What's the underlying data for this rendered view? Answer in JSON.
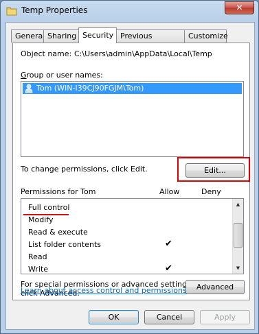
{
  "window": {
    "title": "Temp Properties",
    "close_label": "✕"
  },
  "tabs": [
    {
      "label": "General"
    },
    {
      "label": "Sharing"
    },
    {
      "label": "Security",
      "active": true
    },
    {
      "label": "Previous Versions"
    },
    {
      "label": "Customize"
    }
  ],
  "security": {
    "object_name_label": "Object name:",
    "object_name_value": "C:\\Users\\admin\\AppData\\Local\\Temp",
    "group_label": "Group or user names:",
    "users": [
      {
        "label": "Tom (WIN-I39CJ90FGJM\\Tom)",
        "selected": true,
        "icon": "user-icon"
      }
    ],
    "change_text": "To change permissions, click Edit.",
    "edit_label": "Edit...",
    "perm_header": "Permissions for Tom",
    "allow_header": "Allow",
    "deny_header": "Deny",
    "permissions": [
      {
        "name": "Full control",
        "allow": "",
        "deny": ""
      },
      {
        "name": "Modify",
        "allow": "",
        "deny": ""
      },
      {
        "name": "Read & execute",
        "allow": "",
        "deny": ""
      },
      {
        "name": "List folder contents",
        "allow": "✔",
        "deny": ""
      },
      {
        "name": "Read",
        "allow": "",
        "deny": ""
      },
      {
        "name": "Write",
        "allow": "✔",
        "deny": ""
      }
    ],
    "special_text_1": "For special permissions or advanced settings,",
    "special_text_2": "click Advanced.",
    "advanced_label": "Advanced",
    "learn_link": "Learn about access control and permissions"
  },
  "footer": {
    "ok_label": "OK",
    "cancel_label": "Cancel",
    "apply_label": "Apply"
  },
  "colors": {
    "selection": "#3399ff",
    "annotation_red": "#e00000",
    "link": "#0066cc"
  }
}
